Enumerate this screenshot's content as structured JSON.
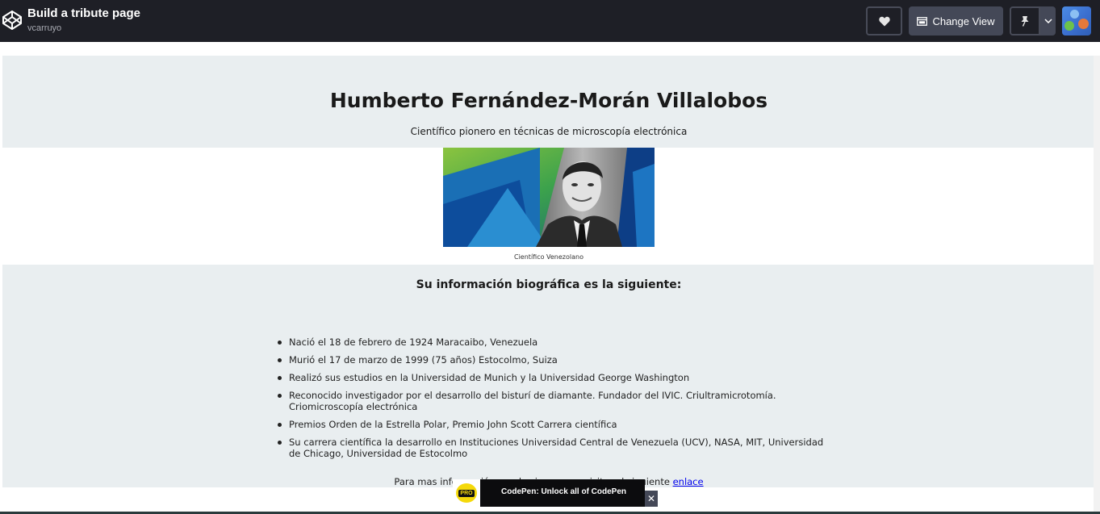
{
  "codepen": {
    "pen_title": "Build a tribute page",
    "author": "vcarruyo",
    "change_view_label": "Change View",
    "icons": {
      "logo": "codepen-logo-icon",
      "heart": "heart-icon",
      "change_view": "layout-icon",
      "pin": "pin-icon",
      "dropdown": "chevron-down-icon",
      "close": "close-icon"
    },
    "promo": {
      "badge": "PRO",
      "text": "CodePen: Unlock all of CodePen",
      "close": "✕"
    }
  },
  "tribute": {
    "title": "Humberto Fernández-Morán Villalobos",
    "subtitle": "Científico pionero en técnicas de microscopía electrónica",
    "image_caption": "Científico Venezolano",
    "bio_heading": "Su información biográfica es la siguiente:",
    "bio_items": [
      "Nació el 18 de febrero de 1924 Maracaibo, Venezuela",
      "Murió el 17 de marzo de 1999 (75 años) Estocolmo, Suiza",
      "Realizó sus estudios en la Universidad de Munich y la Universidad George Washington",
      "Reconocido investigador por el desarrollo del bisturí de diamante. Fundador del IVIC. Criultramicrotomía. Criomicroscopía electrónica",
      "Premios Orden de la Estrella Polar, Premio John Scott Carrera científica",
      "Su carrera científica la desarrollo en Instituciones Universidad Central de Venezuela (UCV), NASA, MIT, Universidad de Chicago, Universidad de Estocolmo"
    ],
    "more_info_text": "Para mas información puedes ingresar y visitar el siguiente",
    "more_info_link": "enlace"
  },
  "colors": {
    "topbar": "#1e1f26",
    "band": "#e9eef0",
    "link": "#0000ee"
  }
}
